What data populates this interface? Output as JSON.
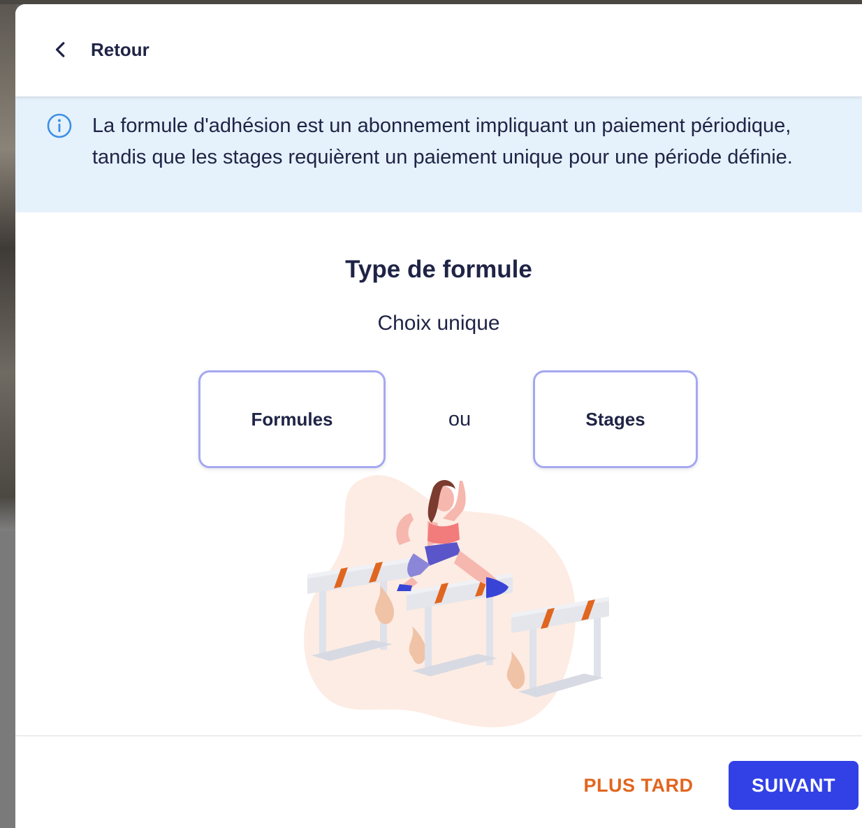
{
  "header": {
    "back_label": "Retour"
  },
  "info_banner": {
    "text": "La formule d'adhésion est un abonnement impliquant un paiement périodique, tandis que les stages requièrent un paiement unique pour une période définie.",
    "icon": "info-circle-icon"
  },
  "main": {
    "title": "Type de formule",
    "subtitle": "Choix unique",
    "options": [
      {
        "label": "Formules"
      },
      {
        "label": "Stages"
      }
    ],
    "separator": "ou"
  },
  "footer": {
    "later_label": "PLUS TARD",
    "next_label": "SUIVANT"
  },
  "colors": {
    "text": "#1f2446",
    "info_bg": "#e5f1fb",
    "info_icon": "#3b8fe6",
    "option_border": "#a5a8f0",
    "later": "#e0661f",
    "primary": "#3241e6"
  }
}
